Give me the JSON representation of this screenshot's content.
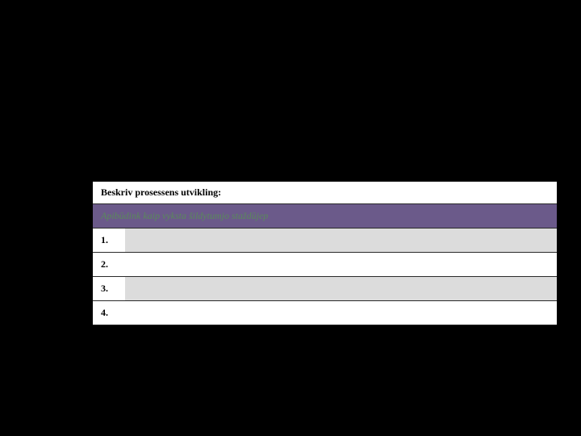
{
  "header": {
    "title": "Beskriv prosessens utvikling:"
  },
  "subheader": {
    "text": "Apibūdink kaip vyksta šildytumjo staždūjep"
  },
  "rows": [
    {
      "number": "1.",
      "shaded": true
    },
    {
      "number": "2.",
      "shaded": false
    },
    {
      "number": "3.",
      "shaded": true
    },
    {
      "number": "4.",
      "shaded": false
    }
  ]
}
